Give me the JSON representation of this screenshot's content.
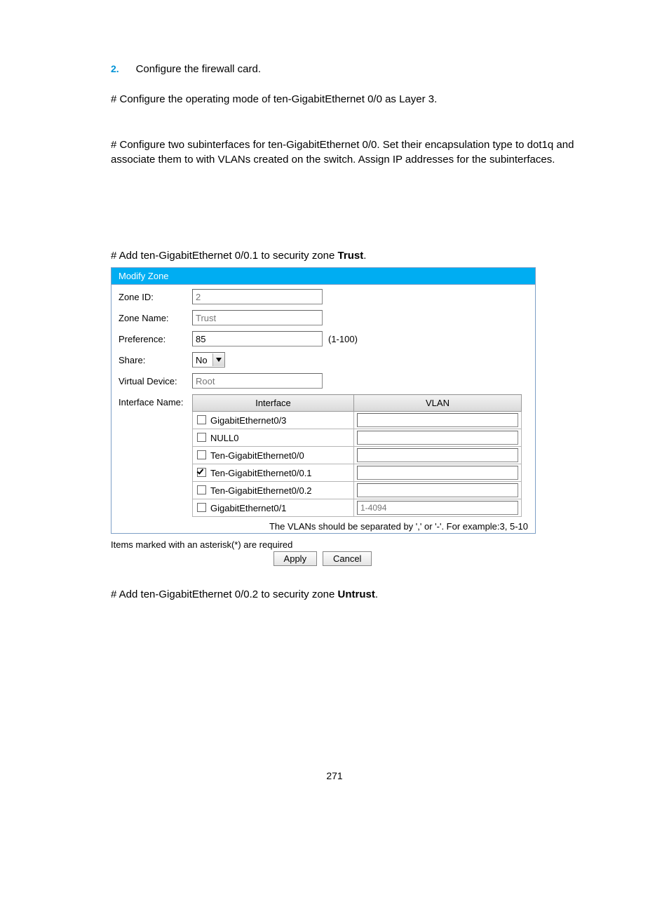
{
  "step": {
    "num": "2.",
    "text": "Configure the firewall card."
  },
  "para1": "# Configure the operating mode of ten-GigabitEthernet 0/0 as Layer 3.",
  "para2": "# Configure two subinterfaces for ten-GigabitEthernet 0/0. Set their encapsulation type to dot1q and associate them to with VLANs created on the switch. Assign IP addresses for the subinterfaces.",
  "para3_pre": "# Add ten-GigabitEthernet 0/0.1 to security zone ",
  "para3_bold": "Trust",
  "para3_post": ".",
  "panel": {
    "header": "Modify Zone",
    "labels": {
      "zone_id": "Zone ID:",
      "zone_name": "Zone Name:",
      "preference": "Preference:",
      "share": "Share:",
      "virtual_device": "Virtual Device:",
      "interface_name": "Interface Name:"
    },
    "values": {
      "zone_id": "2",
      "zone_name": "Trust",
      "preference": "85",
      "pref_range": "(1-100)",
      "share": "No",
      "virtual_device": "Root"
    },
    "table": {
      "headers": {
        "iface": "Interface",
        "vlan": "VLAN"
      },
      "rows": [
        {
          "name": "GigabitEthernet0/3",
          "checked": false,
          "vlan": ""
        },
        {
          "name": "NULL0",
          "checked": false,
          "vlan": ""
        },
        {
          "name": "Ten-GigabitEthernet0/0",
          "checked": false,
          "vlan": ""
        },
        {
          "name": "Ten-GigabitEthernet0/0.1",
          "checked": true,
          "vlan": ""
        },
        {
          "name": "Ten-GigabitEthernet0/0.2",
          "checked": false,
          "vlan": ""
        },
        {
          "name": "GigabitEthernet0/1",
          "checked": false,
          "vlan": "1-4094"
        }
      ]
    },
    "vlan_hint": "The VLANs should be separated by ',' or '-'. For example:3, 5-10"
  },
  "req_note": "Items marked with an asterisk(*) are required",
  "buttons": {
    "apply": "Apply",
    "cancel": "Cancel"
  },
  "para4_pre": "# Add ten-GigabitEthernet 0/0.2 to security zone ",
  "para4_bold": "Untrust",
  "para4_post": ".",
  "page_num": "271"
}
